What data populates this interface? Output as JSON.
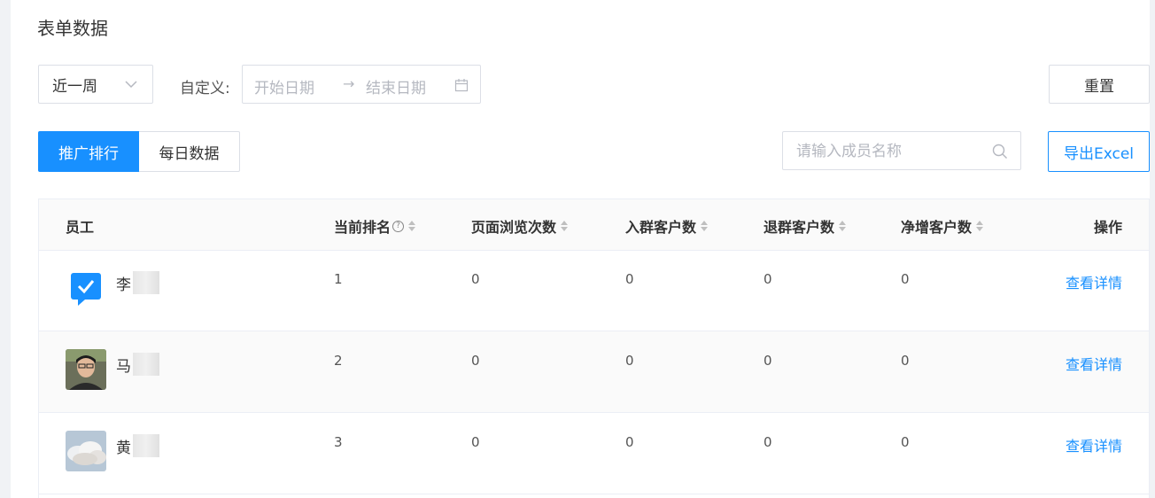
{
  "page": {
    "title": "表单数据"
  },
  "filters": {
    "period": "近一周",
    "custom_label": "自定义:",
    "start_placeholder": "开始日期",
    "end_placeholder": "结束日期",
    "range_separator": "→",
    "reset_label": "重置"
  },
  "tabs": [
    {
      "label": "推广排行",
      "active": true
    },
    {
      "label": "每日数据",
      "active": false
    }
  ],
  "search": {
    "placeholder": "请输入成员名称",
    "value": ""
  },
  "export_label": "导出Excel",
  "table": {
    "columns": [
      "员工",
      "当前排名",
      "页面浏览次数",
      "入群客户数",
      "退群客户数",
      "净增客户数",
      "操作"
    ],
    "help_glyph": "?",
    "rows": [
      {
        "name": "李",
        "rank": "1",
        "views": "0",
        "joined": "0",
        "left": "0",
        "net": "0",
        "action": "查看详情",
        "avatar": "blue-check-icon"
      },
      {
        "name": "马",
        "rank": "2",
        "views": "0",
        "joined": "0",
        "left": "0",
        "net": "0",
        "action": "查看详情",
        "avatar": "photo-person"
      },
      {
        "name": "黄",
        "rank": "3",
        "views": "0",
        "joined": "0",
        "left": "0",
        "net": "0",
        "action": "查看详情",
        "avatar": "photo-sky"
      }
    ]
  },
  "colors": {
    "primary": "#1890ff",
    "border": "#dcdfe6",
    "header_bg": "#fafafa"
  }
}
